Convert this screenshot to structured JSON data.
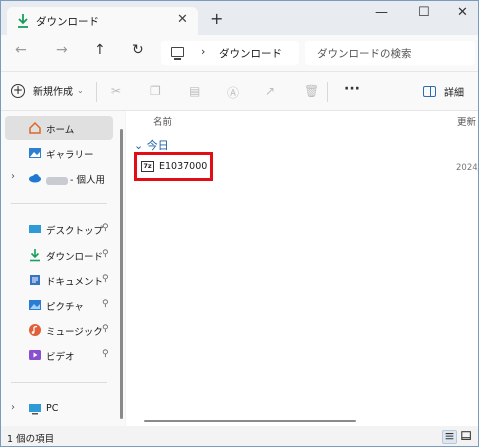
{
  "tab": {
    "title": "ダウンロード",
    "close": "✕",
    "new_tab": "+"
  },
  "window_controls": {
    "minimize": "—",
    "maximize": "☐",
    "close": "✕"
  },
  "nav": {
    "back": "←",
    "forward": "→",
    "up": "↑",
    "refresh": "↻"
  },
  "address": {
    "separator": "›",
    "crumb": "ダウンロード"
  },
  "search": {
    "placeholder": "ダウンロードの検索"
  },
  "toolbar": {
    "new_label": "新規作成",
    "new_chevron": "⌄",
    "more": "···",
    "details_label": "詳細"
  },
  "sidebar": {
    "items": [
      {
        "label": "ホーム",
        "icon": "home-icon"
      },
      {
        "label": "ギャラリー",
        "icon": "gallery-icon"
      },
      {
        "label": "- 個人用",
        "icon": "onedrive-icon"
      },
      {
        "label": "デスクトップ",
        "icon": "desktop-icon",
        "pinned": true
      },
      {
        "label": "ダウンロード",
        "icon": "download-icon",
        "pinned": true
      },
      {
        "label": "ドキュメント",
        "icon": "document-icon",
        "pinned": true
      },
      {
        "label": "ピクチャ",
        "icon": "pictures-icon",
        "pinned": true
      },
      {
        "label": "ミュージック",
        "icon": "music-icon",
        "pinned": true
      },
      {
        "label": "ビデオ",
        "icon": "video-icon",
        "pinned": true
      },
      {
        "label": "PC",
        "icon": "pc-icon"
      }
    ],
    "pin_glyph": "📌",
    "expand_glyph": "›"
  },
  "content": {
    "columns": {
      "name": "名前",
      "modified": "更新"
    },
    "group_label": "今日",
    "group_chevron": "⌄",
    "file": {
      "icon_text": "7z",
      "name": "E1037000",
      "date": "2024/"
    }
  },
  "statusbar": {
    "count": "1 個の項目"
  },
  "colors": {
    "accent": "#2f6bb0",
    "highlight_box": "#e30d18",
    "download_green": "#1a9e5c"
  }
}
